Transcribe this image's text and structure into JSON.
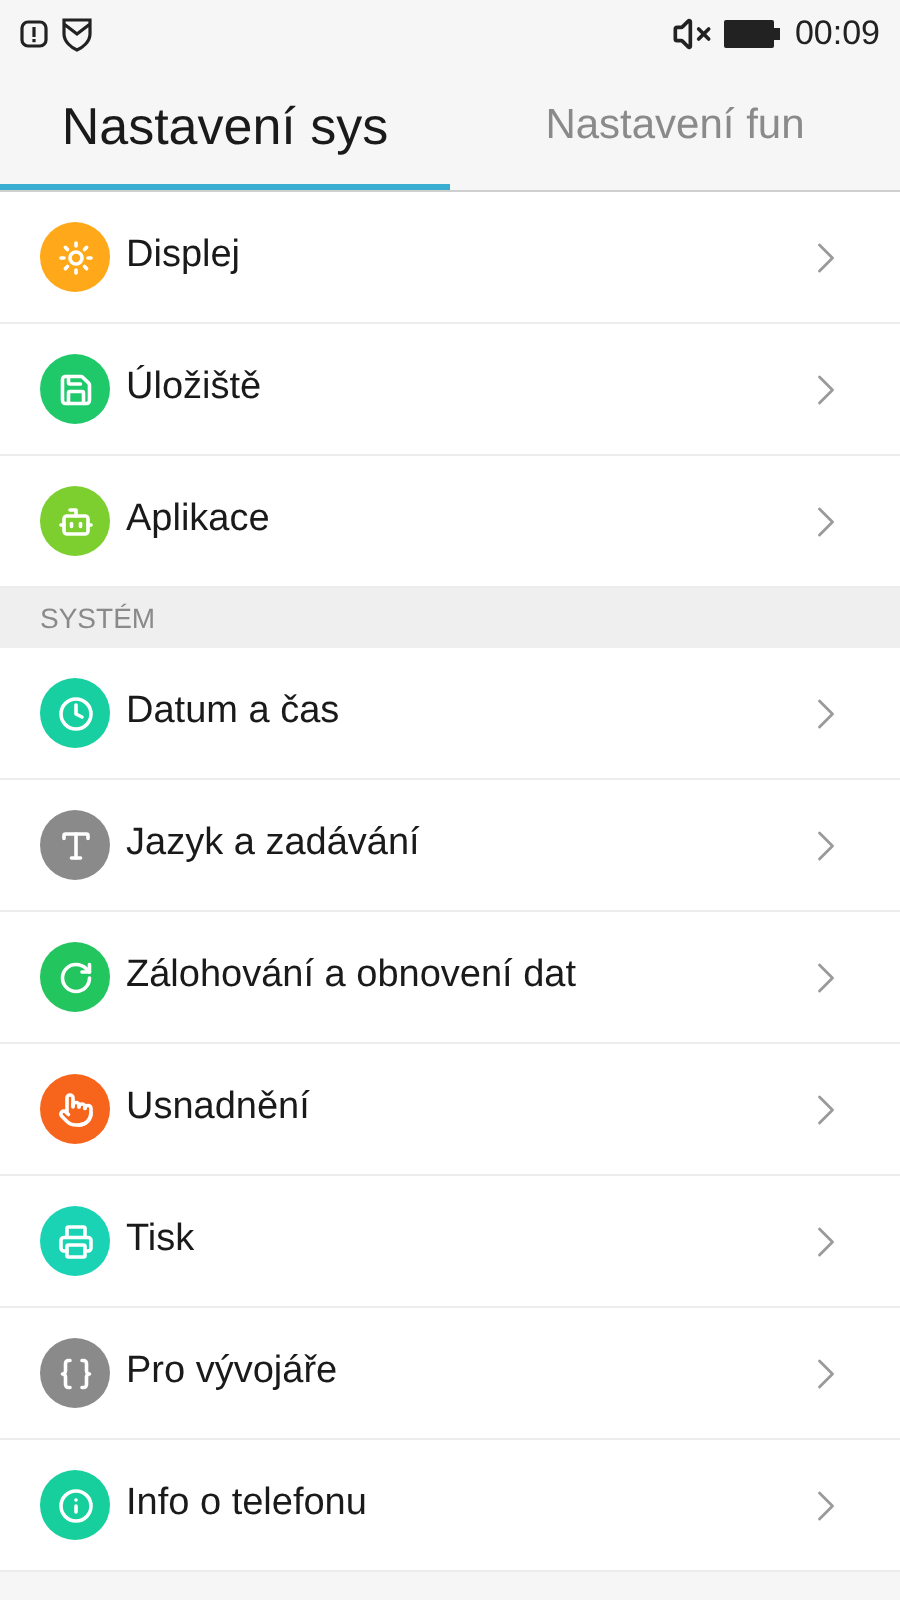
{
  "status_bar": {
    "time": "00:09"
  },
  "tabs": [
    {
      "label": "Nastavení sys",
      "selected": true
    },
    {
      "label": "Nastavení fun",
      "selected": false
    }
  ],
  "sections": [
    {
      "items": [
        {
          "label": "Displej",
          "kind": "display",
          "color": "#ffa81a"
        },
        {
          "label": "Úložiště",
          "kind": "storage",
          "color": "#1fc96a"
        },
        {
          "label": "Aplikace",
          "kind": "apps",
          "color": "#7ccf2e"
        }
      ]
    },
    {
      "header": "SYSTÉM",
      "items": [
        {
          "label": "Datum a čas",
          "kind": "clock",
          "color": "#17cfa0"
        },
        {
          "label": "Jazyk a zadávání",
          "kind": "language",
          "color": "#8a8a8a"
        },
        {
          "label": "Zálohování a obnovení dat",
          "kind": "backup",
          "color": "#22c55e"
        },
        {
          "label": "Usnadnění",
          "kind": "accessibility",
          "color": "#f7641b"
        },
        {
          "label": "Tisk",
          "kind": "print",
          "color": "#19d3b4"
        },
        {
          "label": "Pro vývojáře",
          "kind": "developer",
          "color": "#8a8a8a"
        },
        {
          "label": "Info o telefonu",
          "kind": "info",
          "color": "#17cf9c"
        }
      ]
    }
  ]
}
